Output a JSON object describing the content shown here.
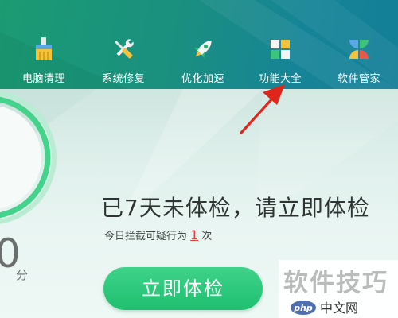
{
  "toolbar": {
    "items": [
      {
        "label": "电脑清理",
        "icon": "broom-icon"
      },
      {
        "label": "系统修复",
        "icon": "wrench-screwdriver-icon"
      },
      {
        "label": "优化加速",
        "icon": "rocket-icon"
      },
      {
        "label": "功能大全",
        "icon": "grid-icon"
      },
      {
        "label": "软件管家",
        "icon": "app-manager-icon"
      }
    ]
  },
  "main": {
    "headline": "已7天未体检，请立即体检",
    "subline_prefix": "今日拦截可疑行为",
    "blocked_count": "1",
    "subline_suffix": "次",
    "score_value": "0",
    "score_unit": "分",
    "scan_button_label": "立即体检"
  },
  "watermark": {
    "text": "软件技巧",
    "brand": "php中文网",
    "brand_prefix": "php",
    "brand_suffix": "中文网"
  },
  "colors": {
    "header_green": "#1b9b72",
    "header_teal": "#147f98",
    "button_green": "#22c174",
    "annotation_red": "#e1251b",
    "alert_red": "#e0403a"
  }
}
